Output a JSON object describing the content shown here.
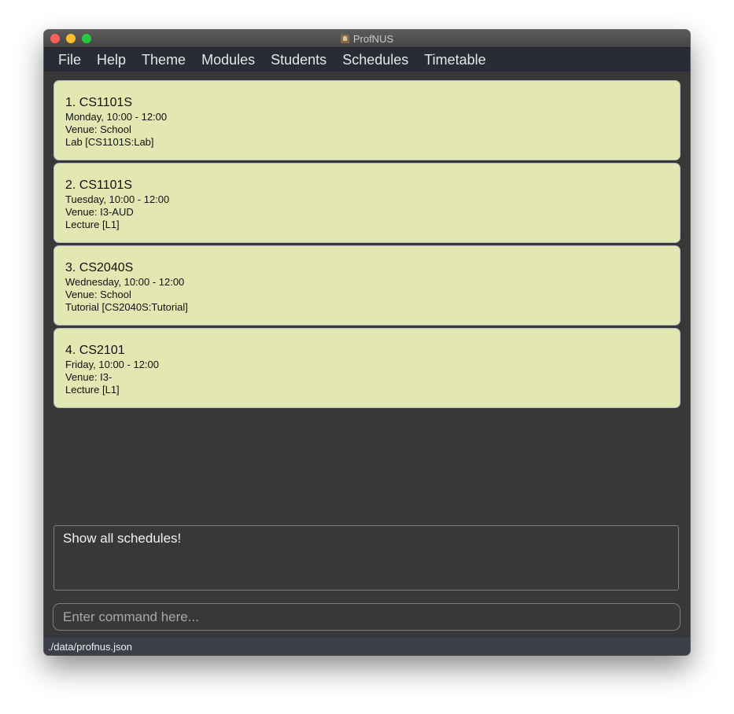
{
  "window": {
    "title": "ProfNUS",
    "app_icon": "app-icon"
  },
  "menu": {
    "items": [
      "File",
      "Help",
      "Theme",
      "Modules",
      "Students",
      "Schedules",
      "Timetable"
    ]
  },
  "schedules": [
    {
      "header": "1.  CS1101S",
      "time": "Monday, 10:00 - 12:00",
      "venue": "Venue: School",
      "type": "Lab  [CS1101S:Lab]"
    },
    {
      "header": "2.  CS1101S",
      "time": "Tuesday, 10:00 - 12:00",
      "venue": "Venue: I3-AUD",
      "type": "Lecture  [L1]"
    },
    {
      "header": "3.  CS2040S",
      "time": "Wednesday, 10:00 - 12:00",
      "venue": "Venue: School",
      "type": "Tutorial  [CS2040S:Tutorial]"
    },
    {
      "header": "4.  CS2101",
      "time": "Friday, 10:00 - 12:00",
      "venue": "Venue: I3-",
      "type": "Lecture  [L1]"
    }
  ],
  "result_display": {
    "text": "Show all schedules!"
  },
  "command_box": {
    "value": "",
    "placeholder": "Enter command here..."
  },
  "status_bar": {
    "path": "./data/profnus.json"
  },
  "colors": {
    "card_background": "#e3e8b3",
    "window_background": "#383838",
    "menubar_background": "#282c34"
  }
}
